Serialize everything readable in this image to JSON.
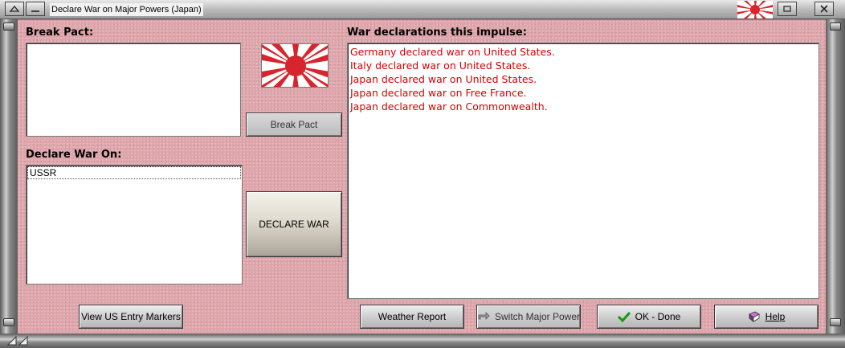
{
  "window": {
    "title": "Declare War on Major Powers (Japan)",
    "accent_color": "#dea6ab",
    "flag_icon": "rising-sun-flag-icon"
  },
  "break_pact": {
    "label": "Break Pact:",
    "items": [],
    "button_label": "Break Pact"
  },
  "declare_war": {
    "label": "Declare War On:",
    "items": [
      "USSR"
    ],
    "button_label": "DECLARE WAR"
  },
  "declarations": {
    "label": "War declarations this impulse:",
    "text_color": "#d40000",
    "lines": [
      "Germany declared war on United States.",
      "Italy declared war on United States.",
      "Japan declared war on United States.",
      "Japan declared war on Free France.",
      "Japan declared war on Commonwealth."
    ]
  },
  "footer": {
    "us_entry_label": "View US Entry Markers",
    "weather_label": "Weather Report",
    "switch_label": "Switch Major Power",
    "ok_label": "OK - Done",
    "help_label": "Help"
  }
}
